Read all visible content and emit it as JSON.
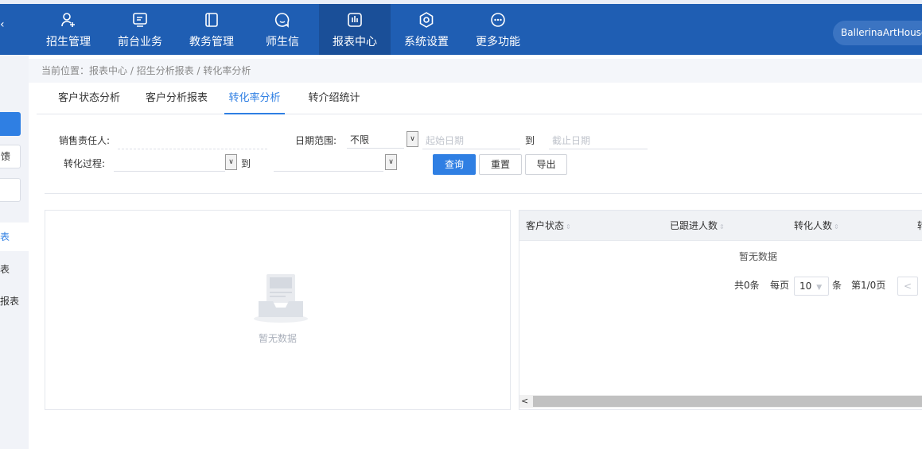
{
  "nav": {
    "items": [
      {
        "label": "招生管理",
        "icon": "user-plus-icon"
      },
      {
        "label": "前台业务",
        "icon": "monitor-icon"
      },
      {
        "label": "教务管理",
        "icon": "book-icon"
      },
      {
        "label": "师生信",
        "icon": "chat-icon"
      },
      {
        "label": "报表中心",
        "icon": "report-icon"
      },
      {
        "label": "系统设置",
        "icon": "settings-icon"
      },
      {
        "label": "更多功能",
        "icon": "more-icon"
      }
    ],
    "active": "报表中心",
    "user": "BallerinaArtHouse"
  },
  "sidebar": {
    "buttons": [
      "",
      "馈",
      ""
    ],
    "items": [
      "表",
      "表",
      "报表"
    ]
  },
  "breadcrumb": "当前位置：报表中心 / 招生分析报表 / 转化率分析",
  "tabs": [
    "客户状态分析",
    "客户分析报表",
    "转化率分析",
    "转介绍统计"
  ],
  "active_tab": "转化率分析",
  "filters": {
    "sales_label": "销售责任人:",
    "date_label": "日期范围:",
    "date_range_value": "不限",
    "start_placeholder": "起始日期",
    "to1": "到",
    "end_placeholder": "截止日期",
    "process_label": "转化过程:",
    "to2": "到"
  },
  "buttons": {
    "query": "查询",
    "reset": "重置",
    "export": "导出"
  },
  "chart": {
    "empty_text": "暂无数据"
  },
  "table": {
    "headers": [
      "客户状态",
      "已跟进人数",
      "转化人数",
      "转"
    ],
    "empty_text": "暂无数据",
    "pager": {
      "total": "共0条",
      "per_page_label": "每页",
      "per_page": "10",
      "unit": "条",
      "page_info": "第1/0页"
    }
  },
  "colors": {
    "primary": "#2f7fe3",
    "nav_bg": "#1f5eb3"
  }
}
